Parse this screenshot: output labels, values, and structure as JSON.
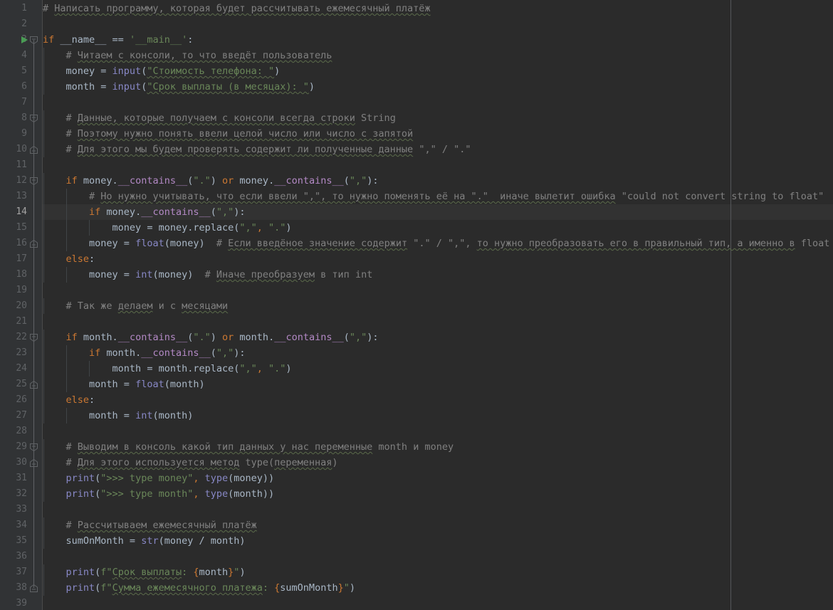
{
  "editor": {
    "name": "python-code-editor",
    "language": "Python",
    "theme": "Darcula",
    "background": "#2B2B2B",
    "gutter_background": "#313335",
    "current_line": 14,
    "current_line_background": "#323232",
    "right_margin_column_guide": true,
    "colors": {
      "keyword": "#CC7832",
      "string": "#6A8759",
      "comment": "#808080",
      "builtin_function": "#8888C6",
      "magic_method": "#B389C5",
      "identifier": "#A9B7C6",
      "line_number": "#606366",
      "line_number_active": "#A4A3A3",
      "run_arrow": "#499C54",
      "fold_marker": "#606366",
      "indent_guide": "#404447",
      "gutter_separator": "#4B4B4B",
      "margin_guide": "#555759",
      "spellcheck_squiggle": "#586B45"
    },
    "gutter": {
      "run_arrow_line": 3,
      "fold_start_lines": [
        3,
        8,
        12,
        22,
        29
      ],
      "fold_end_lines": [
        10,
        16,
        25,
        30,
        38
      ]
    },
    "line_count_visible": 39
  },
  "lines": [
    {
      "n": 1,
      "indent": 0,
      "tokens": [
        {
          "t": "# ",
          "c": "cmt"
        },
        {
          "t": "Написать программу, которая будет рассчитывать ежемесячный платёж",
          "c": "cmt sq"
        }
      ]
    },
    {
      "n": 2,
      "indent": 0,
      "tokens": []
    },
    {
      "n": 3,
      "indent": 0,
      "tokens": [
        {
          "t": "if",
          "c": "kw"
        },
        {
          "t": " __name__ == ",
          "c": "def"
        },
        {
          "t": "'__main__'",
          "c": "str"
        },
        {
          "t": ":",
          "c": "punct"
        }
      ]
    },
    {
      "n": 4,
      "indent": 1,
      "tokens": [
        {
          "t": "# ",
          "c": "cmt"
        },
        {
          "t": "Читаем с консоли, то что введёт пользователь",
          "c": "cmt sq"
        }
      ]
    },
    {
      "n": 5,
      "indent": 1,
      "tokens": [
        {
          "t": "money = ",
          "c": "def"
        },
        {
          "t": "input",
          "c": "fn"
        },
        {
          "t": "(",
          "c": "punct"
        },
        {
          "t": "\"Стоимость телефона: \"",
          "c": "str sq"
        },
        {
          "t": ")",
          "c": "punct"
        }
      ]
    },
    {
      "n": 6,
      "indent": 1,
      "tokens": [
        {
          "t": "month = ",
          "c": "def"
        },
        {
          "t": "input",
          "c": "fn"
        },
        {
          "t": "(",
          "c": "punct"
        },
        {
          "t": "\"Срок выплаты (в месяцах): \"",
          "c": "str sq"
        },
        {
          "t": ")",
          "c": "punct"
        }
      ]
    },
    {
      "n": 7,
      "indent": 0,
      "tokens": []
    },
    {
      "n": 8,
      "indent": 1,
      "tokens": [
        {
          "t": "# ",
          "c": "cmt"
        },
        {
          "t": "Данные, которые получаем с консоли всегда строки",
          "c": "cmt sq"
        },
        {
          "t": " String",
          "c": "cmt"
        }
      ]
    },
    {
      "n": 9,
      "indent": 1,
      "tokens": [
        {
          "t": "# ",
          "c": "cmt"
        },
        {
          "t": "Поэтому нужно понять ввели целой число или число с запятой",
          "c": "cmt sq"
        }
      ]
    },
    {
      "n": 10,
      "indent": 1,
      "tokens": [
        {
          "t": "# ",
          "c": "cmt"
        },
        {
          "t": "Для этого мы будем проверять содержит ли полученные данные",
          "c": "cmt sq"
        },
        {
          "t": " \",\" / \".\"",
          "c": "cmt"
        }
      ]
    },
    {
      "n": 11,
      "indent": 0,
      "tokens": []
    },
    {
      "n": 12,
      "indent": 1,
      "tokens": [
        {
          "t": "if",
          "c": "kw"
        },
        {
          "t": " money.",
          "c": "def"
        },
        {
          "t": "__contains__",
          "c": "magic"
        },
        {
          "t": "(",
          "c": "punct"
        },
        {
          "t": "\".\"",
          "c": "str"
        },
        {
          "t": ") ",
          "c": "punct"
        },
        {
          "t": "or",
          "c": "kw"
        },
        {
          "t": " money.",
          "c": "def"
        },
        {
          "t": "__contains__",
          "c": "magic"
        },
        {
          "t": "(",
          "c": "punct"
        },
        {
          "t": "\",\"",
          "c": "str"
        },
        {
          "t": "):",
          "c": "punct"
        }
      ]
    },
    {
      "n": 13,
      "indent": 2,
      "tokens": [
        {
          "t": "# ",
          "c": "cmt"
        },
        {
          "t": "Но нужно учитывать, что если ввели \",\", то нужно поменять её на \".\"  иначе вылетит ошибка",
          "c": "cmt sq"
        },
        {
          "t": " \"could not convert string to float\"",
          "c": "cmt"
        }
      ]
    },
    {
      "n": 14,
      "indent": 2,
      "tokens": [
        {
          "t": "if",
          "c": "kw"
        },
        {
          "t": " money.",
          "c": "def"
        },
        {
          "t": "__contains__",
          "c": "magic"
        },
        {
          "t": "(",
          "c": "punct"
        },
        {
          "t": "\",\"",
          "c": "str"
        },
        {
          "t": "):",
          "c": "punct"
        }
      ]
    },
    {
      "n": 15,
      "indent": 3,
      "tokens": [
        {
          "t": "money = money.replace(",
          "c": "def"
        },
        {
          "t": "\",\"",
          "c": "str"
        },
        {
          "t": ", ",
          "c": "comma"
        },
        {
          "t": "\".\"",
          "c": "str"
        },
        {
          "t": ")",
          "c": "punct"
        }
      ]
    },
    {
      "n": 16,
      "indent": 2,
      "tokens": [
        {
          "t": "money = ",
          "c": "def"
        },
        {
          "t": "float",
          "c": "fn"
        },
        {
          "t": "(money)  ",
          "c": "def"
        },
        {
          "t": "# ",
          "c": "cmt"
        },
        {
          "t": "Если введёное значение содержит",
          "c": "cmt sq"
        },
        {
          "t": " \".\" / \",\", ",
          "c": "cmt"
        },
        {
          "t": "то нужно преобразовать его в правильный тип, а именно в",
          "c": "cmt sq"
        },
        {
          "t": " float",
          "c": "cmt"
        }
      ]
    },
    {
      "n": 17,
      "indent": 1,
      "tokens": [
        {
          "t": "else",
          "c": "kw"
        },
        {
          "t": ":",
          "c": "punct"
        }
      ]
    },
    {
      "n": 18,
      "indent": 2,
      "tokens": [
        {
          "t": "money = ",
          "c": "def"
        },
        {
          "t": "int",
          "c": "fn"
        },
        {
          "t": "(money)  ",
          "c": "def"
        },
        {
          "t": "# ",
          "c": "cmt"
        },
        {
          "t": "Иначе преобразуем",
          "c": "cmt sq"
        },
        {
          "t": " в тип int",
          "c": "cmt"
        }
      ]
    },
    {
      "n": 19,
      "indent": 0,
      "tokens": []
    },
    {
      "n": 20,
      "indent": 1,
      "tokens": [
        {
          "t": "# ",
          "c": "cmt"
        },
        {
          "t": "Так же ",
          "c": "cmt"
        },
        {
          "t": "делаем",
          "c": "cmt sq"
        },
        {
          "t": " и с ",
          "c": "cmt"
        },
        {
          "t": "месяцами",
          "c": "cmt sq"
        }
      ]
    },
    {
      "n": 21,
      "indent": 0,
      "tokens": []
    },
    {
      "n": 22,
      "indent": 1,
      "tokens": [
        {
          "t": "if",
          "c": "kw"
        },
        {
          "t": " month.",
          "c": "def"
        },
        {
          "t": "__contains__",
          "c": "magic"
        },
        {
          "t": "(",
          "c": "punct"
        },
        {
          "t": "\".\"",
          "c": "str"
        },
        {
          "t": ") ",
          "c": "punct"
        },
        {
          "t": "or",
          "c": "kw"
        },
        {
          "t": " month.",
          "c": "def"
        },
        {
          "t": "__contains__",
          "c": "magic"
        },
        {
          "t": "(",
          "c": "punct"
        },
        {
          "t": "\",\"",
          "c": "str"
        },
        {
          "t": "):",
          "c": "punct"
        }
      ]
    },
    {
      "n": 23,
      "indent": 2,
      "tokens": [
        {
          "t": "if",
          "c": "kw"
        },
        {
          "t": " month.",
          "c": "def"
        },
        {
          "t": "__contains__",
          "c": "magic"
        },
        {
          "t": "(",
          "c": "punct"
        },
        {
          "t": "\",\"",
          "c": "str"
        },
        {
          "t": "):",
          "c": "punct"
        }
      ]
    },
    {
      "n": 24,
      "indent": 3,
      "tokens": [
        {
          "t": "month = month.replace(",
          "c": "def"
        },
        {
          "t": "\",\"",
          "c": "str"
        },
        {
          "t": ", ",
          "c": "comma"
        },
        {
          "t": "\".\"",
          "c": "str"
        },
        {
          "t": ")",
          "c": "punct"
        }
      ]
    },
    {
      "n": 25,
      "indent": 2,
      "tokens": [
        {
          "t": "month = ",
          "c": "def"
        },
        {
          "t": "float",
          "c": "fn"
        },
        {
          "t": "(month)",
          "c": "def"
        }
      ]
    },
    {
      "n": 26,
      "indent": 1,
      "tokens": [
        {
          "t": "else",
          "c": "kw"
        },
        {
          "t": ":",
          "c": "punct"
        }
      ]
    },
    {
      "n": 27,
      "indent": 2,
      "tokens": [
        {
          "t": "month = ",
          "c": "def"
        },
        {
          "t": "int",
          "c": "fn"
        },
        {
          "t": "(month)",
          "c": "def"
        }
      ]
    },
    {
      "n": 28,
      "indent": 0,
      "tokens": []
    },
    {
      "n": 29,
      "indent": 1,
      "tokens": [
        {
          "t": "# ",
          "c": "cmt"
        },
        {
          "t": "Выводим в консоль какой тип данных у нас переменные",
          "c": "cmt sq"
        },
        {
          "t": " month и money",
          "c": "cmt"
        }
      ]
    },
    {
      "n": 30,
      "indent": 1,
      "tokens": [
        {
          "t": "# ",
          "c": "cmt"
        },
        {
          "t": "Для этого используется метод",
          "c": "cmt sq"
        },
        {
          "t": " type(",
          "c": "cmt"
        },
        {
          "t": "переменная",
          "c": "cmt sq"
        },
        {
          "t": ")",
          "c": "cmt"
        }
      ]
    },
    {
      "n": 31,
      "indent": 1,
      "tokens": [
        {
          "t": "print",
          "c": "fn"
        },
        {
          "t": "(",
          "c": "punct"
        },
        {
          "t": "\">>> type money\"",
          "c": "str"
        },
        {
          "t": ", ",
          "c": "comma"
        },
        {
          "t": "type",
          "c": "fn"
        },
        {
          "t": "(money))",
          "c": "def"
        }
      ]
    },
    {
      "n": 32,
      "indent": 1,
      "tokens": [
        {
          "t": "print",
          "c": "fn"
        },
        {
          "t": "(",
          "c": "punct"
        },
        {
          "t": "\">>> type month\"",
          "c": "str"
        },
        {
          "t": ", ",
          "c": "comma"
        },
        {
          "t": "type",
          "c": "fn"
        },
        {
          "t": "(month))",
          "c": "def"
        }
      ]
    },
    {
      "n": 33,
      "indent": 0,
      "tokens": []
    },
    {
      "n": 34,
      "indent": 1,
      "tokens": [
        {
          "t": "# ",
          "c": "cmt"
        },
        {
          "t": "Рассчитываем ежемесячный платёж",
          "c": "cmt sq"
        }
      ]
    },
    {
      "n": 35,
      "indent": 1,
      "tokens": [
        {
          "t": "sumOnMonth = ",
          "c": "def"
        },
        {
          "t": "str",
          "c": "fn"
        },
        {
          "t": "(money / month)",
          "c": "def"
        }
      ]
    },
    {
      "n": 36,
      "indent": 0,
      "tokens": []
    },
    {
      "n": 37,
      "indent": 1,
      "tokens": [
        {
          "t": "print",
          "c": "fn"
        },
        {
          "t": "(",
          "c": "punct"
        },
        {
          "t": "f\"",
          "c": "str"
        },
        {
          "t": "Срок выплаты",
          "c": "str sq"
        },
        {
          "t": ": ",
          "c": "str"
        },
        {
          "t": "{",
          "c": "brace"
        },
        {
          "t": "month",
          "c": "def"
        },
        {
          "t": "}",
          "c": "brace"
        },
        {
          "t": "\"",
          "c": "str"
        },
        {
          "t": ")",
          "c": "punct"
        }
      ]
    },
    {
      "n": 38,
      "indent": 1,
      "tokens": [
        {
          "t": "print",
          "c": "fn"
        },
        {
          "t": "(",
          "c": "punct"
        },
        {
          "t": "f\"",
          "c": "str"
        },
        {
          "t": "Сумма ежемесячного платежа",
          "c": "str sq"
        },
        {
          "t": ": ",
          "c": "str"
        },
        {
          "t": "{",
          "c": "brace"
        },
        {
          "t": "sumOnMonth",
          "c": "def"
        },
        {
          "t": "}",
          "c": "brace"
        },
        {
          "t": "\"",
          "c": "str"
        },
        {
          "t": ")",
          "c": "punct"
        }
      ]
    },
    {
      "n": 39,
      "indent": 0,
      "tokens": []
    }
  ]
}
